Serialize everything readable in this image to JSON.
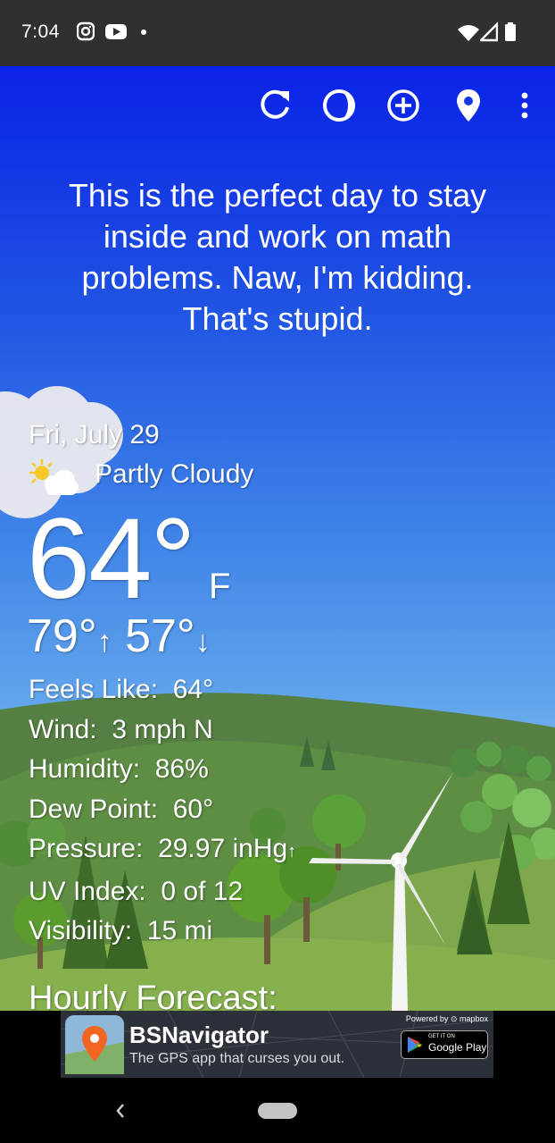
{
  "status_bar": {
    "time": "7:04",
    "icons": [
      "instagram-icon",
      "youtube-icon",
      "notification-dot-icon",
      "wifi-icon",
      "cell-signal-icon",
      "battery-icon"
    ]
  },
  "toolbar": {
    "icons": [
      "refresh-icon",
      "theme-icon",
      "add-location-icon",
      "location-pin-icon",
      "more-vert-icon"
    ]
  },
  "quote": "This is the perfect day to stay inside and work on math problems. Naw, I'm kidding. That's stupid.",
  "weather": {
    "date": "Fri, July 29",
    "condition_icon": "partly-cloudy-icon",
    "condition": "Partly Cloudy",
    "temperature": "64°",
    "unit": "F",
    "high": "79°",
    "high_arrow": "↑",
    "low": "57°",
    "low_arrow": "↓",
    "details": {
      "feels_like_label": "Feels Like:",
      "feels_like": "64°",
      "wind_label": "Wind:",
      "wind": "3 mph N",
      "humidity_label": "Humidity:",
      "humidity": "86%",
      "dew_point_label": "Dew Point:",
      "dew_point": "60°",
      "pressure_label": "Pressure:",
      "pressure": "29.97 inHg",
      "pressure_trend": "↑",
      "uv_label": "UV Index:",
      "uv": "0 of 12",
      "visibility_label": "Visibility:",
      "visibility": "15 mi"
    },
    "hourly_title": "Hourly Forecast:"
  },
  "ad": {
    "title": "BSNavigator",
    "subtitle": "The GPS app that curses you out.",
    "powered_by": "Powered by ⊙ mapbox",
    "store_small": "GET IT ON",
    "store_big": "Google Play",
    "colors": {
      "bg": "#2c3038",
      "pin": "#f26522"
    }
  },
  "colors": {
    "sky_top": "#0a22e6",
    "sky_bottom": "#7db8ef",
    "hills": "#6d9a4a",
    "status_bar": "#303030"
  }
}
